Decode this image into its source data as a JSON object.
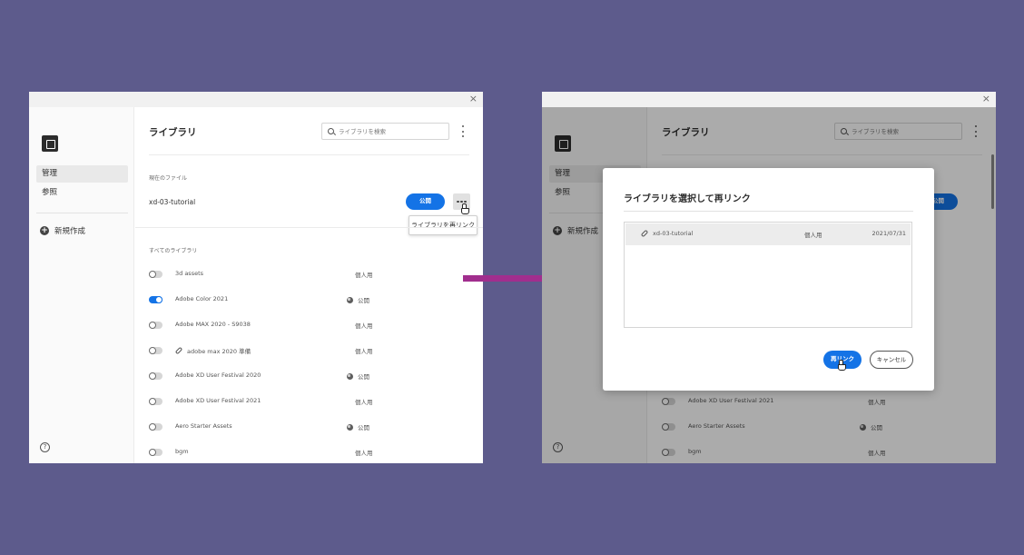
{
  "window": {
    "close": "×"
  },
  "sidebar": {
    "items": [
      {
        "label": "管理"
      },
      {
        "label": "参照"
      }
    ],
    "new_label": "新規作成",
    "help": "?"
  },
  "header": {
    "title": "ライブラリ",
    "search_placeholder": "ライブラリを検索"
  },
  "current_file": {
    "section": "現在のファイル",
    "name": "xd-03-tutorial",
    "publish_label": "公開",
    "tooltip": "ライブラリを再リンク"
  },
  "libraries": {
    "section": "すべてのライブラリ",
    "rows": [
      {
        "name": "3d assets",
        "status": "個人用"
      },
      {
        "name": "Adobe Color 2021",
        "status": "公開"
      },
      {
        "name": "Adobe MAX 2020 - S9038",
        "status": "個人用"
      },
      {
        "name": "adobe max 2020 準備",
        "status": "個人用"
      },
      {
        "name": "Adobe XD User Festival 2020",
        "status": "公開"
      },
      {
        "name": "Adobe XD User Festival 2021",
        "status": "個人用"
      },
      {
        "name": "Aero Starter Assets",
        "status": "公開"
      },
      {
        "name": "bgm",
        "status": "個人用"
      }
    ]
  },
  "dialog": {
    "title": "ライブラリを選択して再リンク",
    "item": {
      "name": "xd-03-tutorial",
      "type": "個人用",
      "date": "2021/07/31"
    },
    "relink_label": "再リンク",
    "cancel_label": "キャンセル"
  },
  "colors": {
    "background": "#5d5b8c",
    "accent": "#1473e6",
    "arrow": "#a12e8e"
  }
}
